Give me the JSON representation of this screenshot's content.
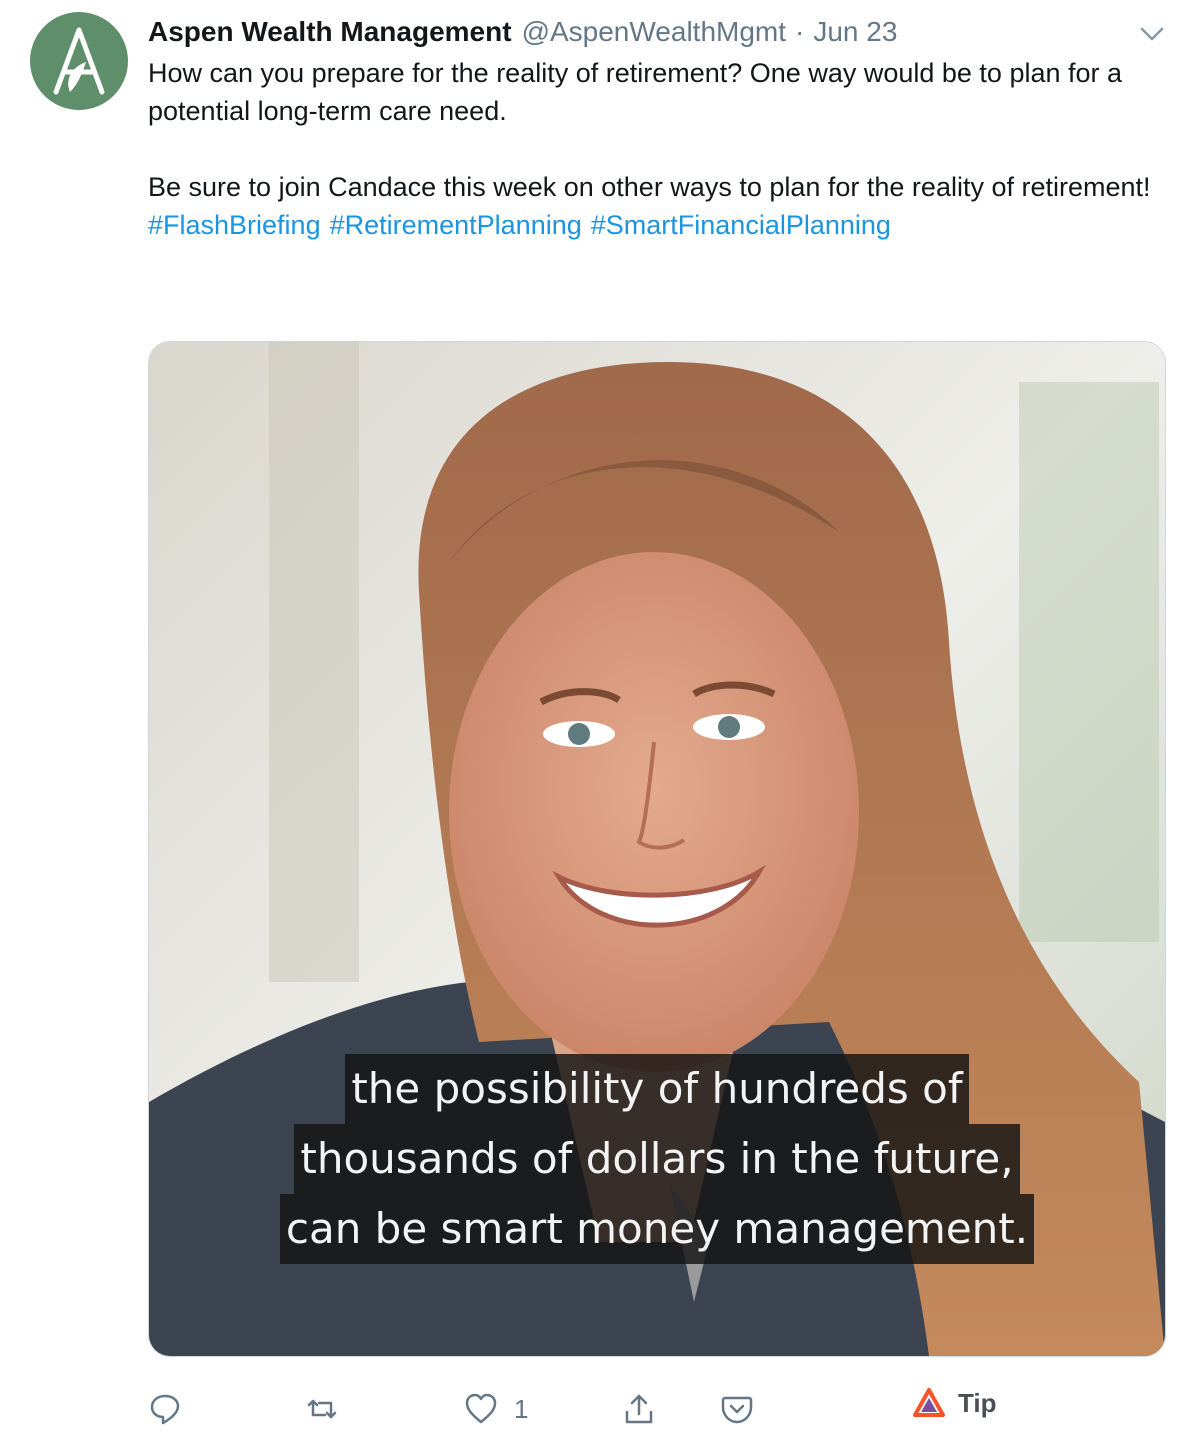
{
  "tweet": {
    "author_name": "Aspen Wealth Management",
    "author_handle": "@AspenWealthMgmt",
    "separator": "·",
    "date": "Jun 23",
    "paragraph_1": "How can you prepare for the reality of retirement? One way would be to plan for a potential long-term care need.",
    "paragraph_2": "Be sure to join Candace this week on other ways to plan for the reality of retirement!",
    "hashtags": [
      "#FlashBriefing",
      "#RetirementPlanning",
      "#SmartFinancialPlanning"
    ],
    "brand_color": "#5e8f6a",
    "link_color": "#1b95e0"
  },
  "media": {
    "captions": [
      "the possibility of hundreds of",
      "thousands of dollars in the future,",
      "can be smart money management."
    ]
  },
  "actions": {
    "reply_icon": "reply-icon",
    "retweet_icon": "retweet-icon",
    "like_icon": "heart-icon",
    "like_count": "1",
    "share_icon": "share-icon",
    "pocket_icon": "pocket-icon",
    "tip_label": "Tip"
  }
}
